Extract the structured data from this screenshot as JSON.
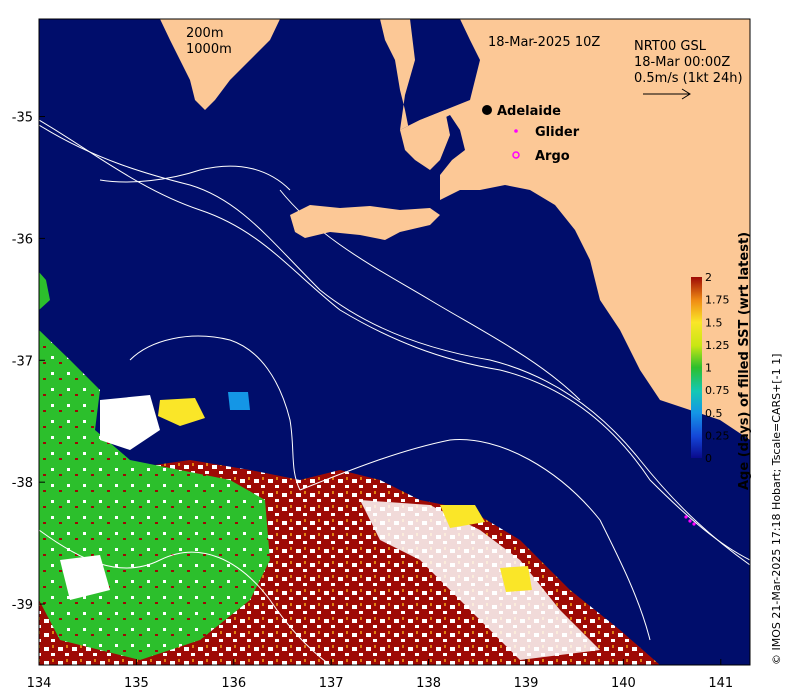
{
  "map": {
    "date_title": "18-Mar-2025 10Z",
    "scale_200": "200m",
    "scale_1000": "1000m",
    "current_source": "NRT00 GSL",
    "current_time": "18-Mar 00:00Z",
    "vector_scale": "0.5m/s (1kt 24h)",
    "places": [
      {
        "name": "Adelaide",
        "lon": 138.6,
        "lat": -34.93
      }
    ],
    "legend": {
      "glider": "Glider",
      "argo": "Argo"
    },
    "x_ticks": [
      "134",
      "135",
      "136",
      "137",
      "138",
      "139",
      "140",
      "141"
    ],
    "y_ticks": [
      "-35",
      "-36",
      "-37",
      "-38",
      "-39"
    ],
    "lon_range": [
      134,
      141.3
    ],
    "lat_range": [
      -39.5,
      -34.2
    ],
    "credit": "© IMOS 21-Mar-2025 17:18 Hobart; Tscale=CARS+[-1 1]"
  },
  "colorbar": {
    "title": "Age (days) of filled SST (wrt latest)",
    "ticks": [
      "2",
      "1.75",
      "1.5",
      "1.25",
      "1",
      "0.75",
      "0.5",
      "0.25",
      "0"
    ],
    "range": [
      0,
      2
    ]
  },
  "colors": {
    "ocean": "#000d6b",
    "land": "#fcc896",
    "age_1": "#2cbf2c",
    "age_2": "#9e0a05",
    "glider": "#ff00ff",
    "argo": "#ff00ff"
  }
}
